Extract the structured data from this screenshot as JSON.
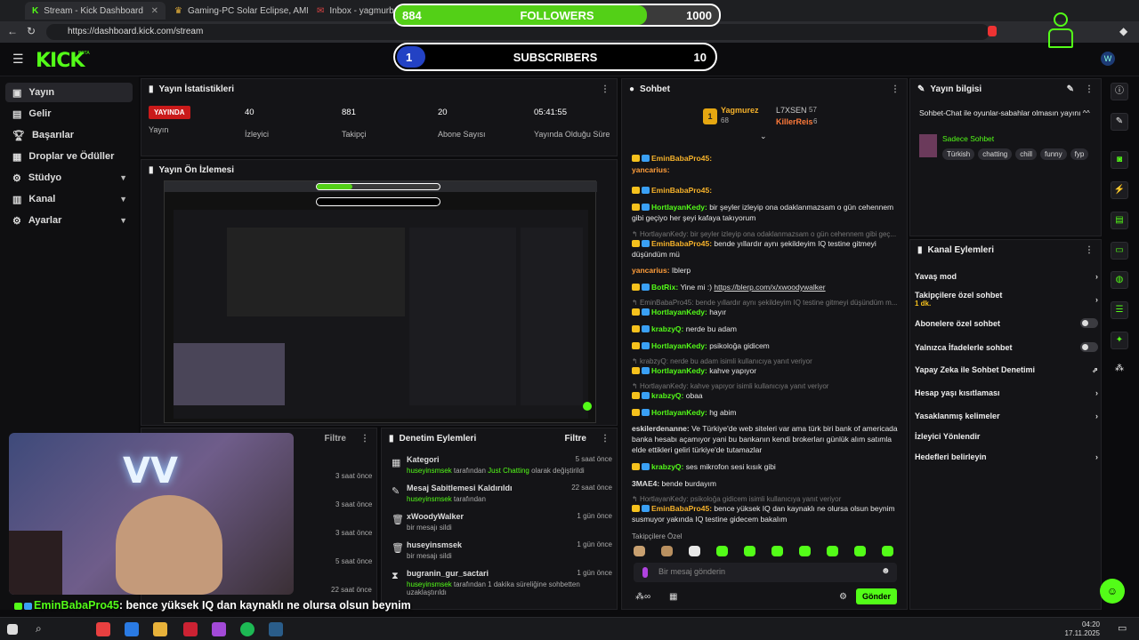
{
  "browser": {
    "tabs": [
      "Stream - Kick Dashboard",
      "Gaming-PC Solar Eclipse, AMD R",
      "Inbox - yagmurbahc"
    ],
    "url": "https://dashboard.kick.com/stream"
  },
  "overlay": {
    "followers": {
      "label": "FOLLOWERS",
      "current": "884",
      "goal": "1000",
      "progress": 0.884
    },
    "subscribers": {
      "label": "SUBSCRIBERS",
      "current": "1",
      "goal": "10",
      "progress": 0.1
    }
  },
  "header": {
    "logo": "KICK",
    "beta": "BETA"
  },
  "nav": {
    "items": [
      {
        "label": "Yayın",
        "icon": "broadcast-icon"
      },
      {
        "label": "Gelir",
        "icon": "wallet-icon"
      },
      {
        "label": "Başarılar",
        "icon": "trophy-icon"
      },
      {
        "label": "Droplar ve Ödüller",
        "icon": "gift-icon"
      },
      {
        "label": "Stüdyo",
        "icon": "studio-icon"
      },
      {
        "label": "Kanal",
        "icon": "channel-icon"
      },
      {
        "label": "Ayarlar",
        "icon": "gear-icon"
      }
    ]
  },
  "stats": {
    "title": "Yayın İstatistikleri",
    "live_badge": "YAYINDA",
    "live_label": "Yayın",
    "viewers": {
      "value": "40",
      "label": "İzleyici"
    },
    "followers": {
      "value": "881",
      "label": "Takipçi"
    },
    "subs": {
      "value": "20",
      "label": "Abone Sayısı"
    },
    "uptime": {
      "value": "05:41:55",
      "label": "Yayında Olduğu Süre"
    }
  },
  "preview": {
    "title": "Yayın Ön İzlemesi"
  },
  "activity": {
    "filter": "Filtre",
    "times": [
      "3 saat önce",
      "3 saat önce",
      "3 saat önce",
      "5 saat önce",
      "22 saat önce"
    ]
  },
  "mod_actions": {
    "title": "Denetim Eylemleri",
    "filter": "Filtre",
    "rows": [
      {
        "title": "Kategori",
        "sub_user": "huseyinsmsek",
        "sub_mid": " tarafından ",
        "sub_hl": "Just Chatting",
        "sub_end": " olarak değiştirildi",
        "time": "5 saat önce"
      },
      {
        "title": "Mesaj Sabitlemesi Kaldırıldı",
        "sub_user": "huseyinsmsek",
        "sub_mid": " tarafından",
        "sub_hl": "",
        "sub_end": "",
        "time": "22 saat önce"
      },
      {
        "title": "xWoodyWalker",
        "sub_user": "",
        "sub_mid": "bir mesajı sildi",
        "sub_hl": "",
        "sub_end": "",
        "time": "1 gün önce"
      },
      {
        "title": "huseyinsmsek",
        "sub_user": "",
        "sub_mid": "bir mesajı sildi",
        "sub_hl": "",
        "sub_end": "",
        "time": "1 gün önce"
      },
      {
        "title": "bugranin_gur_sactari",
        "sub_user": "huseyinsmsek",
        "sub_mid": " tarafından 1 dakika süreliğine sohbetten uzaklaştırıldı",
        "sub_hl": "",
        "sub_end": "",
        "time": "1 gün önce"
      }
    ]
  },
  "chat": {
    "title": "Sohbet",
    "top": [
      {
        "rank": "1",
        "name": "Yagmurez",
        "count": "68"
      },
      {
        "rank": "",
        "name": "L7XSEN",
        "count": "57"
      },
      {
        "rank": "",
        "name": "KillerReis",
        "count": "6"
      }
    ],
    "messages": [
      {
        "user": "EminBabaPro45:",
        "text": ""
      },
      {
        "user": "yancarius:",
        "text": ""
      },
      {
        "user": "EminBabaPro45:",
        "text": ""
      },
      {
        "user": "HortlayanKedy:",
        "text": " bir şeyler izleyip ona odaklanmazsam o gün cehennem gibi geçiyo her şeyi kafaya takıyorum"
      },
      {
        "reply": "HortlayanKedy: bir şeyler izleyip ona odaklanmazsam o gün cehennem gibi geç..."
      },
      {
        "user": "EminBabaPro45:",
        "text": " bende yıllardır aynı şekildeyim IQ testine gitmeyi düşündüm mü"
      },
      {
        "user": "yancarius:",
        "text": " Iblerp"
      },
      {
        "user": "BotRix:",
        "text": " Yine mi :) ",
        "link": "https://blerp.com/x/xwoodywalker"
      },
      {
        "reply": "EminBabaPro45: bende yıllardır aynı şekildeyim IQ testine gitmeyi düşündüm m..."
      },
      {
        "user": "HortlayanKedy:",
        "text": " hayır"
      },
      {
        "user": "krabzyQ:",
        "text": " nerde bu adam"
      },
      {
        "user": "HortlayanKedy:",
        "text": " psikoloğa gidicem"
      },
      {
        "reply": "krabzyQ: nerde bu adam isimli kullanıcıya yanıt veriyor"
      },
      {
        "user": "HortlayanKedy:",
        "text": " kahve yapıyor"
      },
      {
        "reply": "HortlayanKedy: kahve yapıyor isimli kullanıcıya yanıt veriyor"
      },
      {
        "user": "krabzyQ:",
        "text": " obaa"
      },
      {
        "user": "HortlayanKedy:",
        "text": " hg abim"
      },
      {
        "user": "eskilerdenanne:",
        "text": " Ve Türkiye'de web siteleri var ama türk biri bank of americada banka hesabı açamıyor yani bu bankanın kendi brokerları günlük alım satımla elde ettikleri geliri türkiye'de tutamazlar"
      },
      {
        "user": "krabzyQ:",
        "text": " ses mikrofon sesi kısık gibi"
      },
      {
        "user": "3MAE4:",
        "text": " bende burdayım"
      },
      {
        "reply": "HortlayanKedy: psikoloğa gidicem isimli kullanıcıya yanıt veriyor"
      },
      {
        "user": "EminBabaPro45:",
        "text": " bence yüksek IQ dan kaynaklı ne olursa olsun beynim susmuyor yakında IQ testine gidecem bakalım"
      }
    ],
    "emote_label": "Takipçilere Özel",
    "input_placeholder": "Bir mesaj gönderin",
    "send": "Gönder"
  },
  "stream_info": {
    "title": "Yayın bilgisi",
    "stream_title": "Sohbet-Chat ile oyunlar-sabahlar olmasın yayını ^^",
    "category": "Sadece Sohbet",
    "tags": [
      "Türkish",
      "chatting",
      "chill",
      "funny",
      "fyp"
    ]
  },
  "channel_actions": {
    "title": "Kanal Eylemleri",
    "rows": [
      {
        "label": "Yavaş mod",
        "ctl": "chevron"
      },
      {
        "label": "Takipçilere özel sohbet",
        "sub": "1 dk.",
        "ctl": "chevron"
      },
      {
        "label": "Abonelere özel sohbet",
        "ctl": "toggle"
      },
      {
        "label": "Yalnızca İfadelerle sohbet",
        "ctl": "toggle"
      },
      {
        "label": "Yapay Zeka ile Sohbet Denetimi",
        "ctl": "ext"
      },
      {
        "label": "Hesap yaşı kısıtlaması",
        "ctl": "chevron"
      },
      {
        "label": "Yasaklanmış kelimeler",
        "ctl": "chevron"
      },
      {
        "label": "İzleyici Yönlendir",
        "ctl": ""
      },
      {
        "label": "Hedefleri belirleyin",
        "ctl": "chevron"
      }
    ]
  },
  "caption": {
    "user": "EminBabaPro45",
    "text": ": bence yüksek IQ dan kaynaklı ne olursa olsun beynim susmuyor yakında IQ testine gidecem bakalım"
  },
  "taskbar": {
    "time": "04:20",
    "date": "17.11.2025"
  },
  "colors": {
    "brand": "#53fc18",
    "live": "#ca1a1a",
    "bg": "#0b0b0d"
  }
}
